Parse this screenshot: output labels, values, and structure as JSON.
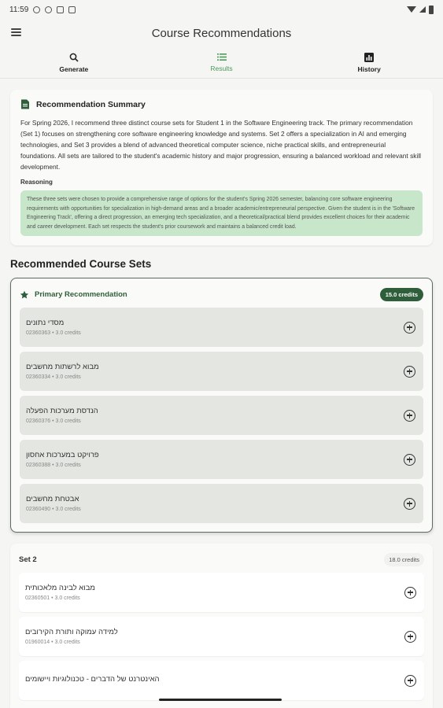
{
  "status_bar": {
    "time": "11:59"
  },
  "app_bar": {
    "title": "Course Recommendations"
  },
  "tabs": [
    {
      "label": "Generate",
      "icon": "search-icon"
    },
    {
      "label": "Results",
      "icon": "list-icon"
    },
    {
      "label": "History",
      "icon": "chart-icon"
    }
  ],
  "summary": {
    "title": "Recommendation Summary",
    "text": "For Spring 2026, I recommend three distinct course sets for Student 1 in the Software Engineering track. The primary recommendation (Set 1) focuses on strengthening core software engineering knowledge and systems. Set 2 offers a specialization in AI and emerging technologies, and Set 3 provides a blend of advanced theoretical computer science, niche practical skills, and entrepreneurial foundations. All sets are tailored to the student's academic history and major progression, ensuring a balanced workload and relevant skill development.",
    "reasoning_label": "Reasoning",
    "reasoning_text": "These three sets were chosen to provide a comprehensive range of options for the student's Spring 2026 semester, balancing core software engineering requirements with opportunities for specialization in high-demand areas and a broader academic/entrepreneurial perspective. Given the student is in the 'Software Engineering Track', offering a direct progression, an emerging tech specialization, and a theoretical/practical blend provides excellent choices for their academic and career development. Each set respects the student's prior coursework and maintains a balanced credit load."
  },
  "section_title": "Recommended Course Sets",
  "primary_set": {
    "title": "Primary Recommendation",
    "credits": "15.0 credits",
    "courses": [
      {
        "name": "מסדי נתונים",
        "meta": "02360363 • 3.0 credits"
      },
      {
        "name": "מבוא לרשתות מחשבים",
        "meta": "02360334 • 3.0 credits"
      },
      {
        "name": "הנדסת מערכות הפעלה",
        "meta": "02360376 • 3.0 credits"
      },
      {
        "name": "פרויקט במערכות אחסון",
        "meta": "02360388 • 3.0 credits"
      },
      {
        "name": "אבטחת מחשבים",
        "meta": "02360490 • 3.0 credits"
      }
    ]
  },
  "set2": {
    "title": "Set 2",
    "credits": "18.0 credits",
    "courses": [
      {
        "name": "מבוא לבינה מלאכותית",
        "meta": "02360501 • 3.0 credits"
      },
      {
        "name": "למידה עמוקה ותורת הקירובים",
        "meta": "01960014 • 3.0 credits"
      },
      {
        "name": "האינטרנט של הדברים - טכנולוגיות ויישומים",
        "meta": ""
      }
    ]
  },
  "colors": {
    "accent": "#2e5e3a",
    "active_tab": "#4c9a5a",
    "reasoning_bg": "#c8e6c9"
  }
}
